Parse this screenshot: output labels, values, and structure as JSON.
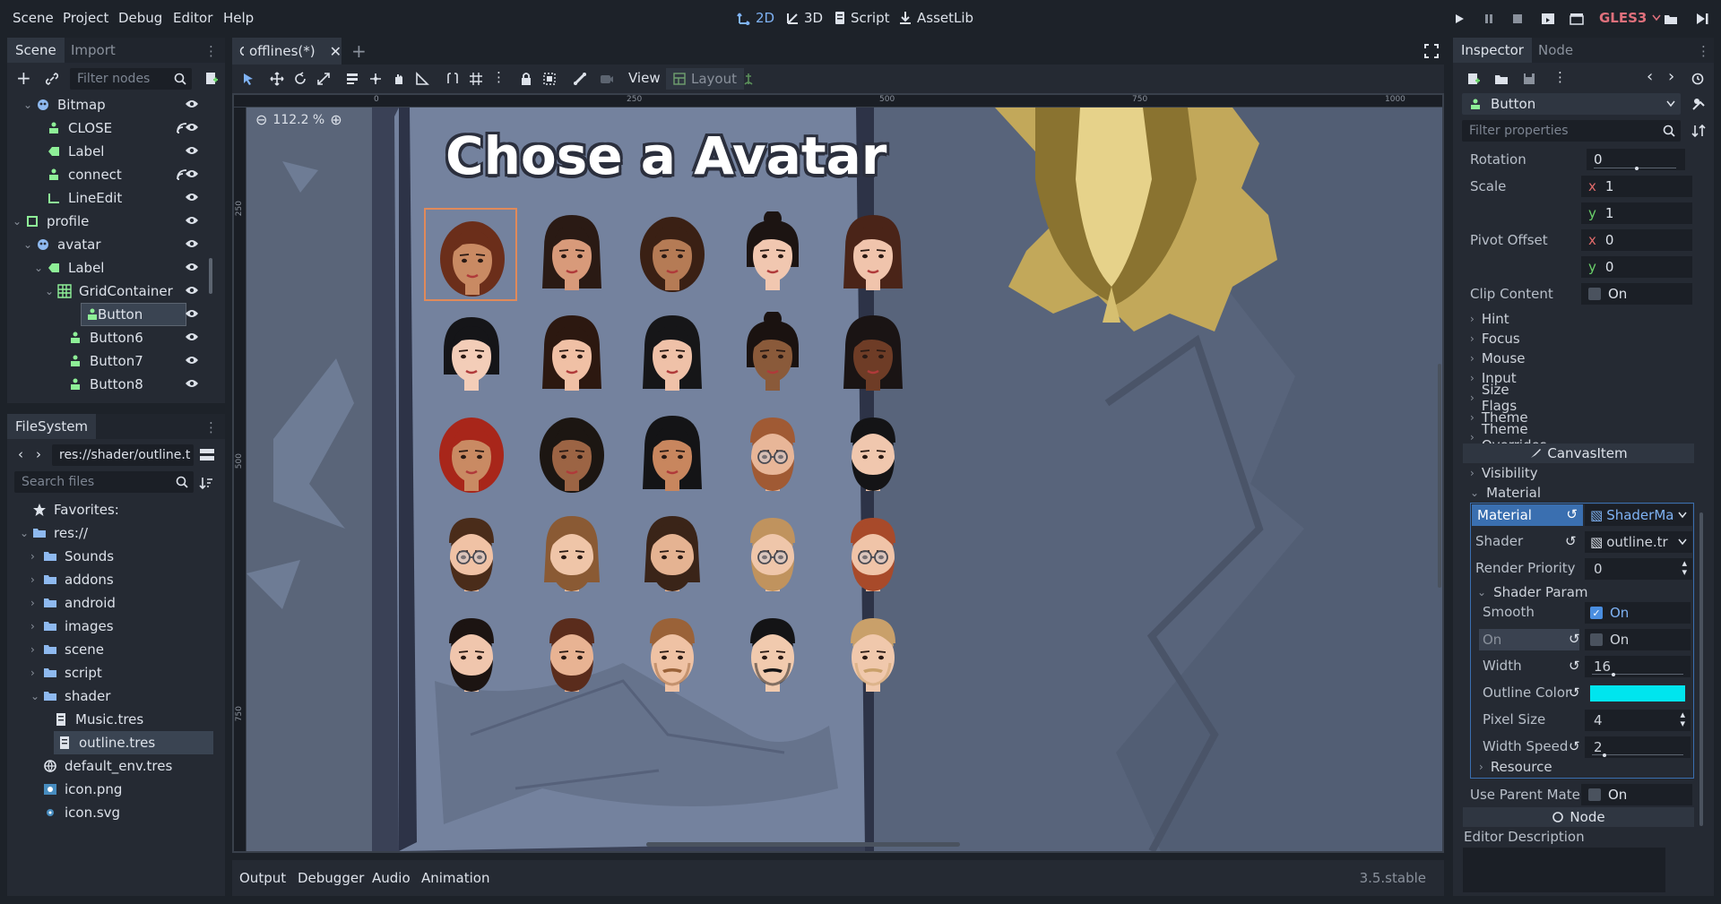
{
  "menu": [
    "Scene",
    "Project",
    "Debug",
    "Editor",
    "Help"
  ],
  "modes": {
    "two_d": "2D",
    "three_d": "3D",
    "script": "Script",
    "assetlib": "AssetLib"
  },
  "renderer": "GLES3",
  "scene_panel": {
    "tabs": [
      "Scene",
      "Import"
    ],
    "filter_placeholder": "Filter nodes",
    "nodes": [
      {
        "label": "Bitmap",
        "type": "control",
        "depth": 1,
        "expanded": true
      },
      {
        "label": "CLOSE",
        "type": "button",
        "depth": 2,
        "signal": true
      },
      {
        "label": "Label",
        "type": "label",
        "depth": 2
      },
      {
        "label": "connect",
        "type": "button",
        "depth": 2,
        "signal": true
      },
      {
        "label": "LineEdit",
        "type": "lineedit",
        "depth": 2
      },
      {
        "label": "profile",
        "type": "panel",
        "depth": 0,
        "expanded": true
      },
      {
        "label": "avatar",
        "type": "control",
        "depth": 1,
        "expanded": true
      },
      {
        "label": "Label",
        "type": "label",
        "depth": 2,
        "expanded": true
      },
      {
        "label": "GridContainer",
        "type": "grid",
        "depth": 3,
        "expanded": true
      },
      {
        "label": "Button",
        "type": "button",
        "depth": 4,
        "selected": true
      },
      {
        "label": "Button6",
        "type": "button",
        "depth": 4
      },
      {
        "label": "Button7",
        "type": "button",
        "depth": 4
      },
      {
        "label": "Button8",
        "type": "button",
        "depth": 4
      }
    ]
  },
  "filesystem": {
    "tab": "FileSystem",
    "path": "res://shader/outline.t",
    "search_placeholder": "Search files",
    "items": [
      {
        "label": "Favorites:",
        "kind": "star",
        "depth": 0
      },
      {
        "label": "res://",
        "kind": "folder",
        "depth": 0,
        "expanded": true
      },
      {
        "label": "Sounds",
        "kind": "folder",
        "depth": 1
      },
      {
        "label": "addons",
        "kind": "folder",
        "depth": 1
      },
      {
        "label": "android",
        "kind": "folder",
        "depth": 1
      },
      {
        "label": "images",
        "kind": "folder",
        "depth": 1
      },
      {
        "label": "scene",
        "kind": "folder",
        "depth": 1
      },
      {
        "label": "script",
        "kind": "folder",
        "depth": 1
      },
      {
        "label": "shader",
        "kind": "folder",
        "depth": 1,
        "expanded": true
      },
      {
        "label": "Music.tres",
        "kind": "resource",
        "depth": 2
      },
      {
        "label": "outline.tres",
        "kind": "resource",
        "depth": 2,
        "selected": true
      },
      {
        "label": "default_env.tres",
        "kind": "env",
        "depth": 1
      },
      {
        "label": "icon.png",
        "kind": "image",
        "depth": 1
      },
      {
        "label": "icon.svg",
        "kind": "svg",
        "depth": 1
      }
    ]
  },
  "editor": {
    "tab": "offlines(*)",
    "toolbar": {
      "view": "View",
      "layout": "Layout"
    },
    "zoom": "112.2 %",
    "ruler_x": [
      "0",
      "250",
      "500",
      "750",
      "1000"
    ],
    "ruler_y": [
      "250",
      "500",
      "750"
    ],
    "title": "Chose a Avatar"
  },
  "inspector": {
    "tabs": [
      "Inspector",
      "Node"
    ],
    "node_type": "Button",
    "filter_placeholder": "Filter properties",
    "rotation": {
      "label": "Rotation",
      "value": "0"
    },
    "scale": {
      "label": "Scale",
      "x": "1",
      "y": "1"
    },
    "pivot": {
      "label": "Pivot Offset",
      "x": "0",
      "y": "0"
    },
    "clip": {
      "label": "Clip Content",
      "value": "On"
    },
    "sections": [
      "Hint",
      "Focus",
      "Mouse",
      "Input",
      "Size Flags",
      "Theme",
      "Theme Overrides"
    ],
    "canvas_item": "CanvasItem",
    "visibility": "Visibility",
    "material_section": "Material",
    "material": {
      "label": "Material",
      "value": "ShaderMa"
    },
    "shader": {
      "label": "Shader",
      "value": "outline.tr"
    },
    "render_priority": {
      "label": "Render Priority",
      "value": "0"
    },
    "shader_param": "Shader Param",
    "smooth": {
      "label": "Smooth",
      "value": "On",
      "checked": true
    },
    "on": {
      "label": "On",
      "value": "On",
      "checked": false
    },
    "width": {
      "label": "Width",
      "value": "16"
    },
    "outline_color": {
      "label": "Outline Color",
      "color": "#00e5ee"
    },
    "pixel_size": {
      "label": "Pixel Size",
      "value": "4"
    },
    "width_speed": {
      "label": "Width Speed",
      "value": "2"
    },
    "resource": "Resource",
    "use_parent": {
      "label": "Use Parent Mater",
      "value": "On"
    },
    "node_section": "Node",
    "editor_description": "Editor Description"
  },
  "bottom": {
    "tabs": [
      "Output",
      "Debugger",
      "Audio",
      "Animation"
    ],
    "version": "3.5.stable"
  },
  "colors": {
    "accent": "#7fb3f5",
    "selection": "#3a4452",
    "panel": "#252a33",
    "canvas": "#6e7f99"
  },
  "avatars": [
    {
      "hair": "#6b2e1a",
      "skin": "#c98a63",
      "style": "curly",
      "selected": true
    },
    {
      "hair": "#2a1a14",
      "skin": "#d89a7a",
      "style": "long"
    },
    {
      "hair": "#3a2014",
      "skin": "#b57b55",
      "style": "curly"
    },
    {
      "hair": "#1c1412",
      "skin": "#f1c7b0",
      "style": "bun"
    },
    {
      "hair": "#4a2418",
      "skin": "#f0c4ac",
      "style": "long"
    },
    {
      "hair": "#151518",
      "skin": "#f3cdb8",
      "style": "bob"
    },
    {
      "hair": "#2c1810",
      "skin": "#f0c0a5",
      "style": "long"
    },
    {
      "hair": "#161618",
      "skin": "#efc1a8",
      "style": "long"
    },
    {
      "hair": "#1a1210",
      "skin": "#8a5a3a",
      "style": "bun"
    },
    {
      "hair": "#1a1414",
      "skin": "#6e3c26",
      "style": "long"
    },
    {
      "hair": "#a8261a",
      "skin": "#c98a63",
      "style": "curly"
    },
    {
      "hair": "#1c1612",
      "skin": "#9c6444",
      "style": "curly"
    },
    {
      "hair": "#141416",
      "skin": "#c8865e",
      "style": "long"
    },
    {
      "hair": "#a05a34",
      "skin": "#e8b698",
      "style": "man-glasses"
    },
    {
      "hair": "#141416",
      "skin": "#f0c7ae",
      "style": "man-beard"
    },
    {
      "hair": "#4a2c1a",
      "skin": "#f0c2a5",
      "style": "man-glasses"
    },
    {
      "hair": "#8a5a34",
      "skin": "#efc5a8",
      "style": "man-long"
    },
    {
      "hair": "#3a2418",
      "skin": "#e5b392",
      "style": "man-long"
    },
    {
      "hair": "#c0935e",
      "skin": "#efc6aa",
      "style": "man-glasses"
    },
    {
      "hair": "#a84a2a",
      "skin": "#f0c4a8",
      "style": "man-glasses"
    },
    {
      "hair": "#1c1412",
      "skin": "#f0c6ad",
      "style": "man-beard"
    },
    {
      "hair": "#5a2c1c",
      "skin": "#e8b393",
      "style": "man-beard"
    },
    {
      "hair": "#9a6238",
      "skin": "#efc2a4",
      "style": "man"
    },
    {
      "hair": "#141416",
      "skin": "#f1caae",
      "style": "man"
    },
    {
      "hair": "#c9a06a",
      "skin": "#f0c8ac",
      "style": "man"
    }
  ]
}
